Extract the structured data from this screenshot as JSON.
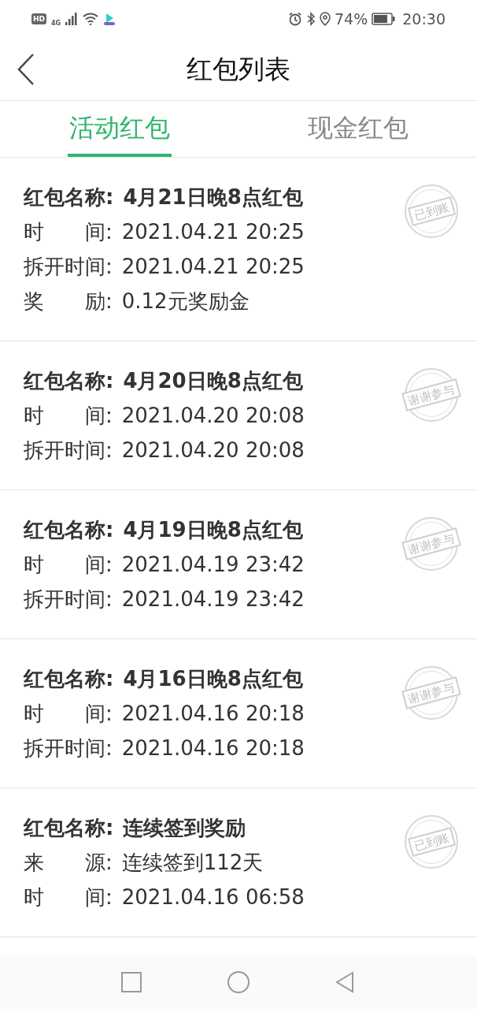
{
  "status_bar": {
    "hd": "HD",
    "network": "4G",
    "battery": "74%",
    "time": "20:30"
  },
  "header": {
    "title": "红包列表"
  },
  "tabs": [
    {
      "label": "活动红包",
      "selected": true
    },
    {
      "label": "现金红包",
      "selected": false
    }
  ],
  "items": [
    {
      "title_label": "红包名称:",
      "title": "4月21日晚8点红包",
      "stamp": "已到账",
      "fields": [
        {
          "label": "时　　间:",
          "value": "2021.04.21 20:25"
        },
        {
          "label": "拆开时间:",
          "value": "2021.04.21 20:25"
        },
        {
          "label": "奖　　励:",
          "value": "0.12元奖励金"
        }
      ]
    },
    {
      "title_label": "红包名称:",
      "title": "4月20日晚8点红包",
      "stamp": "谢谢参与",
      "fields": [
        {
          "label": "时　　间:",
          "value": "2021.04.20 20:08"
        },
        {
          "label": "拆开时间:",
          "value": "2021.04.20 20:08"
        }
      ]
    },
    {
      "title_label": "红包名称:",
      "title": "4月19日晚8点红包",
      "stamp": "谢谢参与",
      "fields": [
        {
          "label": "时　　间:",
          "value": "2021.04.19 23:42"
        },
        {
          "label": "拆开时间:",
          "value": "2021.04.19 23:42"
        }
      ]
    },
    {
      "title_label": "红包名称:",
      "title": "4月16日晚8点红包",
      "stamp": "谢谢参与",
      "fields": [
        {
          "label": "时　　间:",
          "value": "2021.04.16 20:18"
        },
        {
          "label": "拆开时间:",
          "value": "2021.04.16 20:18"
        }
      ]
    },
    {
      "title_label": "红包名称:",
      "title": "连续签到奖励",
      "stamp": "已到账",
      "fields": [
        {
          "label": "来　　源:",
          "value": "连续签到112天"
        },
        {
          "label": "时　　间:",
          "value": "2021.04.16 06:58"
        }
      ]
    }
  ]
}
